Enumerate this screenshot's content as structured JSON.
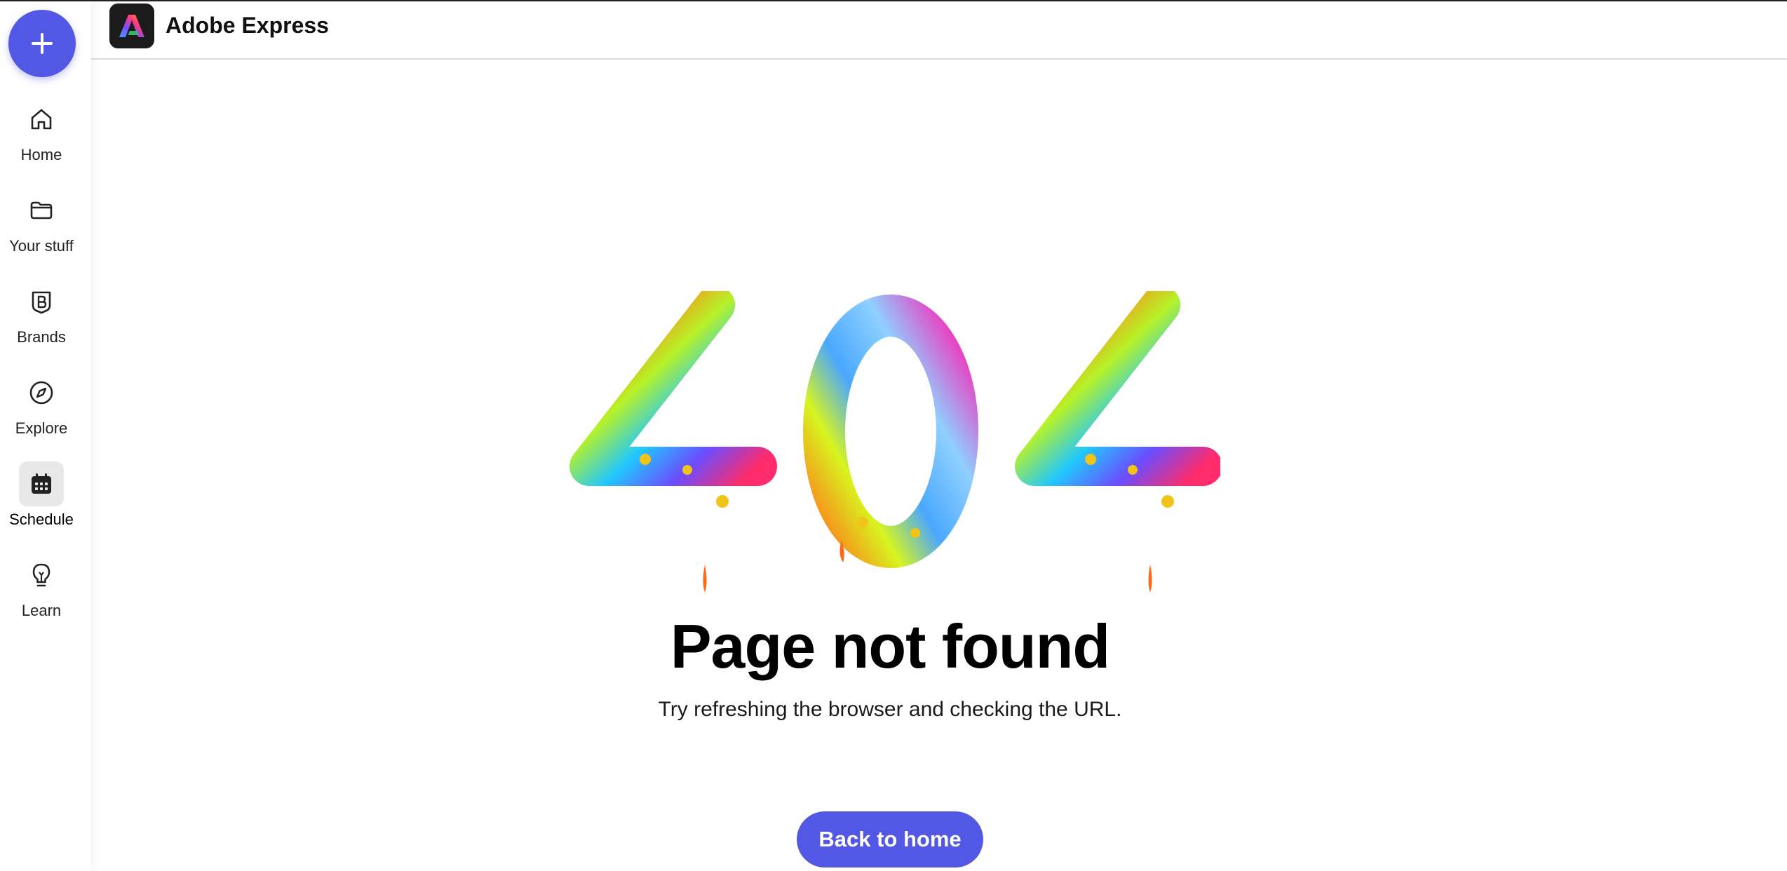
{
  "header": {
    "app_title": "Adobe Express",
    "logo_icon": "adobe-express-logo"
  },
  "sidebar": {
    "create_icon": "plus-icon",
    "items": [
      {
        "label": "Home",
        "icon": "home-icon",
        "active": false
      },
      {
        "label": "Your stuff",
        "icon": "folder-icon",
        "active": false
      },
      {
        "label": "Brands",
        "icon": "brand-icon",
        "active": false
      },
      {
        "label": "Explore",
        "icon": "compass-icon",
        "active": false
      },
      {
        "label": "Schedule",
        "icon": "calendar-icon",
        "active": true
      },
      {
        "label": "Learn",
        "icon": "lightbulb-icon",
        "active": false
      }
    ]
  },
  "main": {
    "error_code": "404",
    "title": "Page not found",
    "subtitle": "Try refreshing the browser and checking the URL.",
    "button_label": "Back to home"
  },
  "colors": {
    "accent": "#5258e4",
    "active_bg": "#e8e8e8",
    "text": "#111111"
  }
}
